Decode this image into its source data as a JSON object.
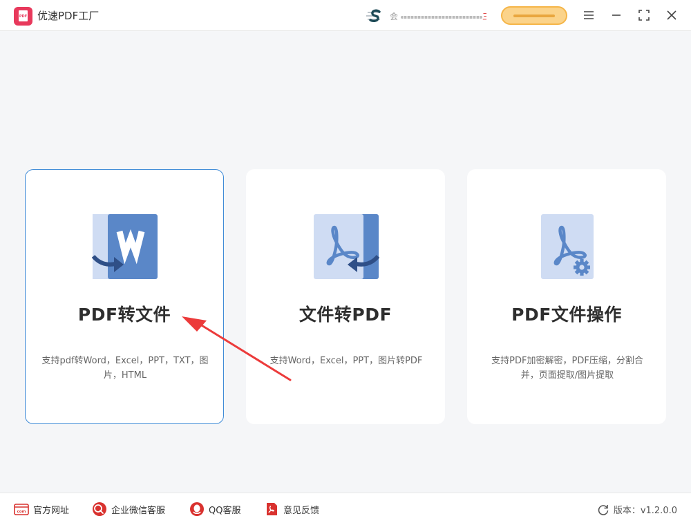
{
  "app": {
    "title": "优速PDF工厂",
    "logo_text": "PDF"
  },
  "header": {
    "user_prefix": "会",
    "user_suffix": "三"
  },
  "cards": [
    {
      "title": "PDF转文件",
      "desc": "支持pdf转Word，Excel，PPT，TXT，图片，HTML",
      "icon": "word-document-icon",
      "selected": true
    },
    {
      "title": "文件转PDF",
      "desc": "支持Word，Excel，PPT，图片转PDF",
      "icon": "pdf-document-icon",
      "selected": false
    },
    {
      "title": "PDF文件操作",
      "desc": "支持PDF加密解密，PDF压缩，分割合并，页面提取/图片提取",
      "icon": "pdf-settings-icon",
      "selected": false
    }
  ],
  "footer": {
    "links": [
      {
        "label": "官方网址",
        "icon": "website-icon"
      },
      {
        "label": "企业微信客服",
        "icon": "wechat-work-icon"
      },
      {
        "label": "QQ客服",
        "icon": "qq-icon"
      },
      {
        "label": "意见反馈",
        "icon": "feedback-icon"
      }
    ],
    "version_label": "版本：v1.2.0.0"
  },
  "colors": {
    "accent": "#3f8bd7",
    "brand": "#e8395c",
    "icon_dark": "#5a87c8",
    "icon_light": "#cfdcf3",
    "footer_red": "#d9322f",
    "vip": "#fbd38a"
  }
}
